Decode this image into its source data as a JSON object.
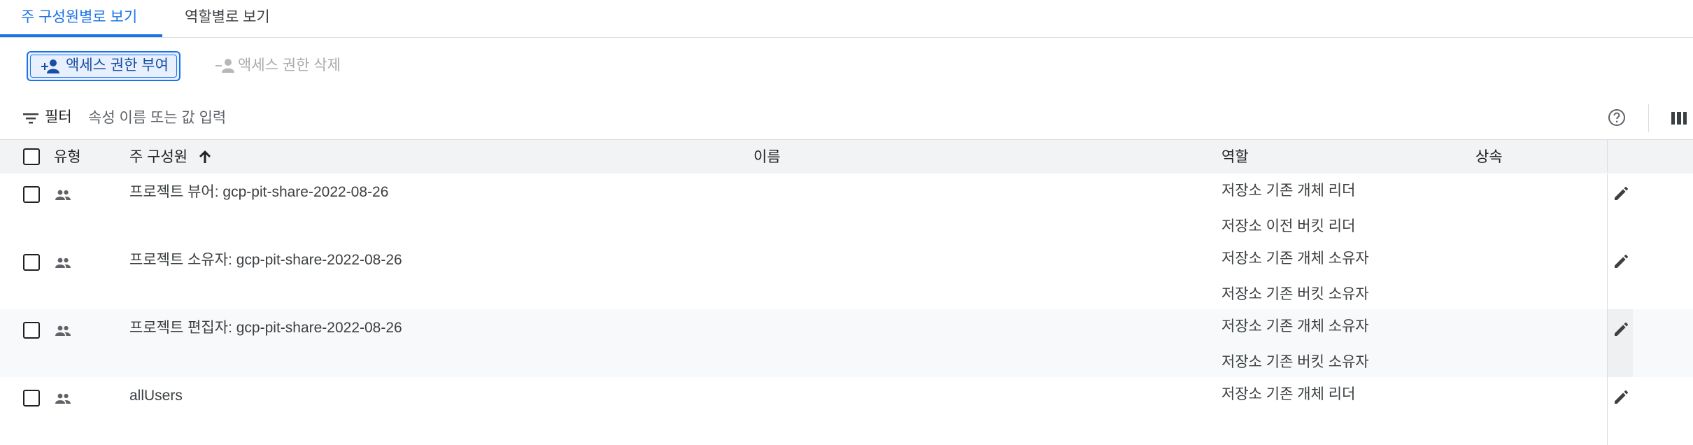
{
  "tabs": [
    {
      "label": "주 구성원별로 보기",
      "active": true
    },
    {
      "label": "역할별로 보기",
      "active": false
    }
  ],
  "toolbar": {
    "grant_label": "액세스 권한 부여",
    "remove_label": "액세스 권한 삭제"
  },
  "filter": {
    "label": "필터",
    "placeholder": "속성 이름 또는 값 입력"
  },
  "table": {
    "headers": {
      "type": "유형",
      "principal": "주 구성원",
      "name": "이름",
      "role": "역할",
      "inheritance": "상속"
    },
    "rows": [
      {
        "principal": "프로젝트 뷰어: gcp-pit-share-2022-08-26",
        "roles": [
          "저장소 기존 개체 리더",
          "저장소 이전 버킷 리더"
        ]
      },
      {
        "principal": "프로젝트 소유자: gcp-pit-share-2022-08-26",
        "roles": [
          "저장소 기존 개체 소유자",
          "저장소 기존 버킷 소유자"
        ]
      },
      {
        "principal": "프로젝트 편집자: gcp-pit-share-2022-08-26",
        "roles": [
          "저장소 기존 개체 소유자",
          "저장소 기존 버킷 소유자"
        ]
      },
      {
        "principal": "allUsers",
        "roles": [
          "저장소 기존 개체 리더"
        ]
      }
    ]
  },
  "icons": {
    "grant": "person-add-icon",
    "remove": "person-remove-icon",
    "filter": "filter-list-icon",
    "help": "help-circle-icon",
    "columns": "view-columns-icon",
    "sort": "arrow-upward-icon",
    "type": "group-icon",
    "edit": "pencil-edit-icon"
  },
  "colors": {
    "accent": "#1a73e8",
    "button_bg": "#e8f0fe",
    "header_bg": "#f1f3f4",
    "divider": "#dadce0"
  }
}
